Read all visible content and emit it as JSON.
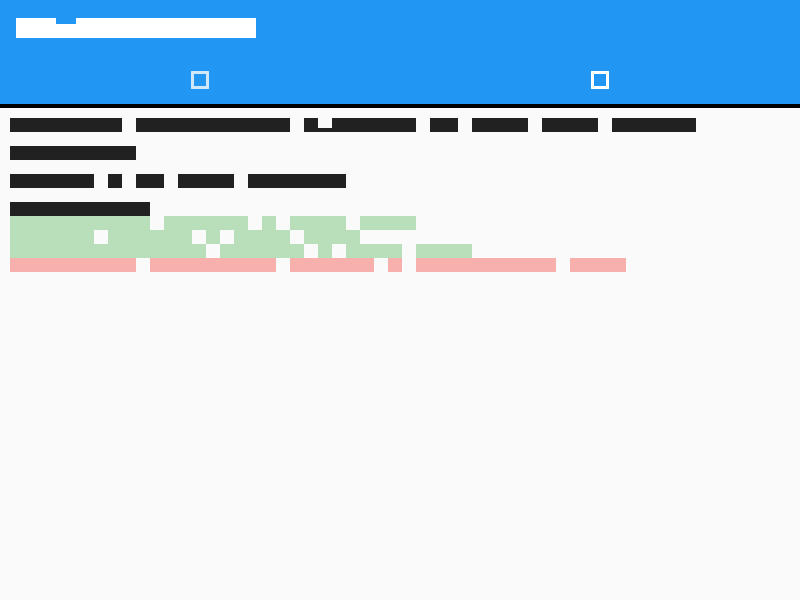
{
  "app": {
    "title": ""
  },
  "tabs": [
    {
      "icon": "square-icon",
      "selected": false
    },
    {
      "icon": "square-icon",
      "selected": true
    }
  ],
  "colors": {
    "appbar": "#2196f3",
    "text": "#212121",
    "added": "#b8dfb9",
    "removed": "#f7b0ac",
    "background": "#fafafa"
  },
  "content": {
    "lines": [
      {
        "words": [
          "",
          "",
          "",
          "",
          "",
          "",
          ""
        ]
      },
      {
        "words": [
          ""
        ]
      },
      {
        "words": [
          "",
          "",
          "",
          "",
          ""
        ]
      },
      {
        "words": [
          ""
        ]
      }
    ]
  }
}
